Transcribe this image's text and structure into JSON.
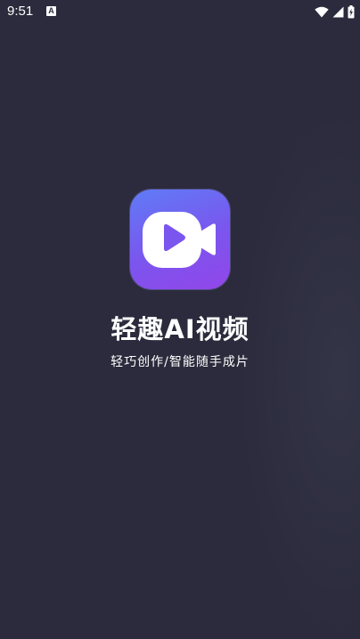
{
  "status_bar": {
    "time": "9:51",
    "notification_badge": "A",
    "icons": [
      "wifi-icon",
      "signal-icon",
      "battery-icon"
    ]
  },
  "app": {
    "logo_icon": "video-camera-play-icon",
    "title": "轻趣AI视频",
    "slogan": "轻巧创作/智能随手成片"
  },
  "colors": {
    "background": "#2b2b3d",
    "logo_gradient_start": "#5f7cf6",
    "logo_gradient_end": "#9346ea",
    "play_triangle": "#7a55ee",
    "text": "#ffffff"
  }
}
